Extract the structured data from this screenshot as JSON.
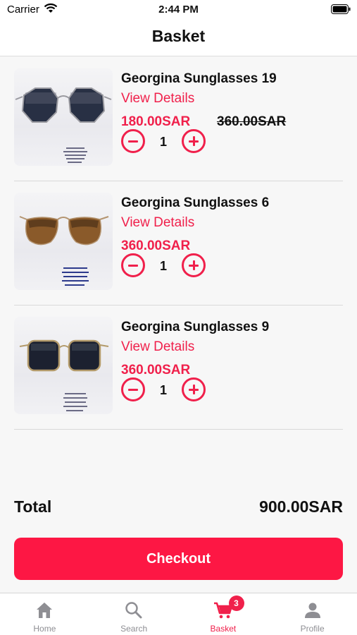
{
  "status_bar": {
    "carrier": "Carrier",
    "time": "2:44 PM"
  },
  "header": {
    "title": "Basket"
  },
  "items": [
    {
      "name": "Georgina Sunglasses 19",
      "details_label": "View Details",
      "price": "180.00SAR",
      "old_price": "360.00SAR",
      "quantity": "1"
    },
    {
      "name": "Georgina Sunglasses 6",
      "details_label": "View Details",
      "price": "360.00SAR",
      "old_price": "",
      "quantity": "1"
    },
    {
      "name": "Georgina Sunglasses 9",
      "details_label": "View Details",
      "price": "360.00SAR",
      "old_price": "",
      "quantity": "1"
    }
  ],
  "summary": {
    "total_label": "Total",
    "total_value": "900.00SAR"
  },
  "checkout": {
    "label": "Checkout"
  },
  "tabbar": {
    "tabs": [
      {
        "label": "Home",
        "icon": "home-icon"
      },
      {
        "label": "Search",
        "icon": "search-icon"
      },
      {
        "label": "Basket",
        "icon": "cart-icon",
        "badge": "3",
        "active": true
      },
      {
        "label": "Profile",
        "icon": "profile-icon"
      }
    ]
  },
  "colors": {
    "accent": "#f0204b",
    "checkout_bg": "#fd1744",
    "inactive_tab": "#8e8e93"
  }
}
